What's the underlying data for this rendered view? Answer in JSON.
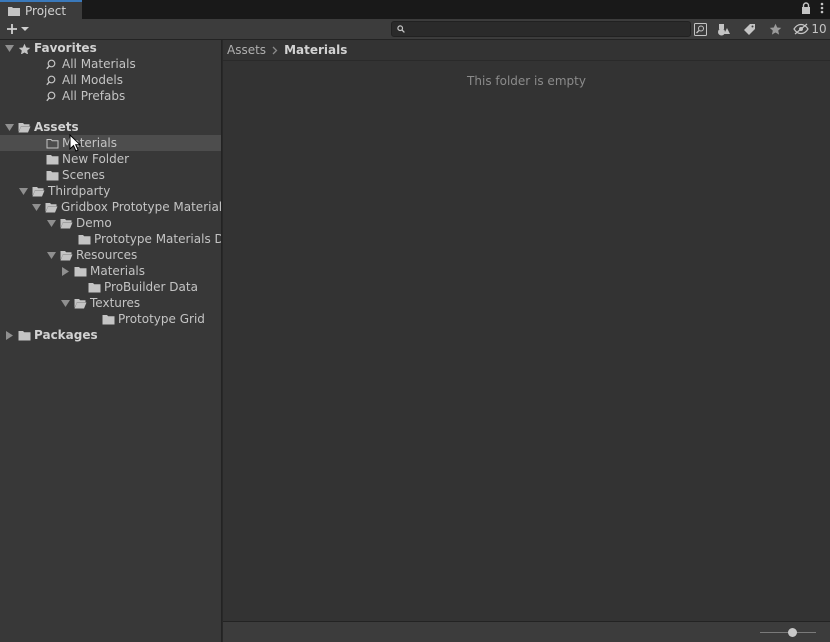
{
  "tab": {
    "label": "Project"
  },
  "search": {
    "value": "",
    "placeholder": ""
  },
  "toolbar": {
    "hidden_count": "10"
  },
  "tree": [
    {
      "label": "Favorites",
      "indent": 0,
      "expanded": true,
      "icon": "star-icon",
      "header": true
    },
    {
      "label": "All Materials",
      "indent": 2,
      "icon": "search-icon"
    },
    {
      "label": "All Models",
      "indent": 2,
      "icon": "search-icon"
    },
    {
      "label": "All Prefabs",
      "indent": 2,
      "icon": "search-icon"
    },
    {
      "label": "Assets",
      "indent": 0,
      "expanded": true,
      "icon": "folder-open-icon",
      "header": true
    },
    {
      "label": "Materials",
      "indent": 2,
      "icon": "folder-empty-icon",
      "selected": true
    },
    {
      "label": "New Folder",
      "indent": 2,
      "icon": "folder-icon"
    },
    {
      "label": "Scenes",
      "indent": 2,
      "icon": "folder-icon"
    },
    {
      "label": "Thirdparty",
      "indent": 1,
      "expanded": true,
      "icon": "folder-open-icon"
    },
    {
      "label": "Gridbox Prototype Materials",
      "indent": 2,
      "expanded": true,
      "icon": "folder-open-icon"
    },
    {
      "label": "Demo",
      "indent": 3,
      "expanded": true,
      "icon": "folder-open-icon"
    },
    {
      "label": "Prototype Materials De",
      "indent": 5,
      "icon": "folder-icon"
    },
    {
      "label": "Resources",
      "indent": 3,
      "expanded": true,
      "icon": "folder-open-icon"
    },
    {
      "label": "Materials",
      "indent": 4,
      "expanded": false,
      "icon": "folder-icon"
    },
    {
      "label": "ProBuilder Data",
      "indent": 5,
      "icon": "folder-icon"
    },
    {
      "label": "Textures",
      "indent": 4,
      "expanded": true,
      "icon": "folder-open-icon"
    },
    {
      "label": "Prototype Grid",
      "indent": 6,
      "icon": "folder-icon"
    },
    {
      "label": "Packages",
      "indent": 0,
      "expanded": false,
      "icon": "folder-icon",
      "header": true
    }
  ],
  "breadcrumb": {
    "root": "Assets",
    "current": "Materials"
  },
  "content": {
    "empty_message": "This folder is empty"
  },
  "colors": {
    "tab_accent": "#3a79bb",
    "selection": "#4d4d4d"
  }
}
